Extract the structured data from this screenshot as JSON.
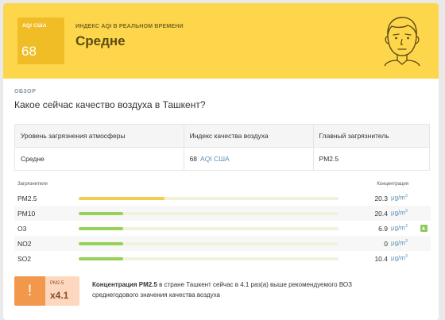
{
  "hero": {
    "aqi_label": "AQI США",
    "aqi_value": "68",
    "subtitle": "ИНДЕКС AQI В РЕАЛЬНОМ ВРЕМЕНИ",
    "level": "Средне",
    "color": "#fdd64b",
    "icon": "face-icon"
  },
  "overview": {
    "section_label": "ОБЗОР",
    "question": "Какое сейчас качество воздуха в Ташкент?"
  },
  "summary": {
    "headers": [
      "Уровень загрязнения атмосферы",
      "Индекс качества воздуха",
      "Главный загрязнитель"
    ],
    "level": "Средне",
    "aqi_value": "68",
    "aqi_unit": "AQI США",
    "main_pollutant": "PM2.5"
  },
  "pollutants": {
    "header_left": "Загрязнители",
    "header_right": "Концентрация",
    "unit": "μg/m",
    "unit_sup": "3",
    "items": [
      {
        "name": "PM2.5",
        "value": "20.3",
        "level": 0.33,
        "color": "#f4cd4a",
        "trend_up": false
      },
      {
        "name": "PM10",
        "value": "20.4",
        "level": 0.17,
        "color": "#96d15a",
        "trend_up": false
      },
      {
        "name": "O3",
        "value": "6.9",
        "level": 0.17,
        "color": "#96d15a",
        "trend_up": true
      },
      {
        "name": "NO2",
        "value": "0",
        "level": 0.17,
        "color": "#96d15a",
        "trend_up": false
      },
      {
        "name": "SO2",
        "value": "10.4",
        "level": 0.17,
        "color": "#96d15a",
        "trend_up": false
      }
    ]
  },
  "who": {
    "badge_symbol": "!",
    "badge_label": "PM2.5",
    "multiplier": "x4.1",
    "text_bold": "Концентрация PM2.5",
    "text_rest": " в стране Ташкент сейчас в 4.1 раз(а) выше рекомендуемого ВОЗ среднегодового значения качества воздуха"
  }
}
